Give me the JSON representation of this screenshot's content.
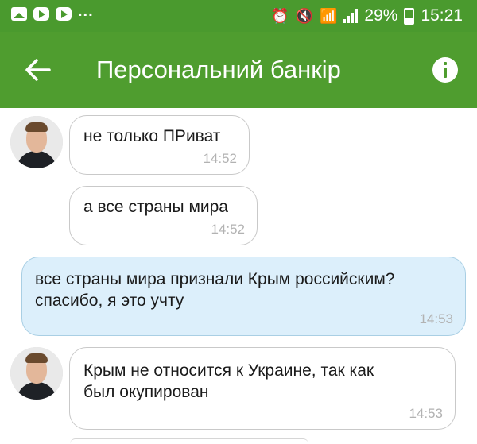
{
  "status_bar": {
    "time": "15:21",
    "battery": "29%",
    "overflow": "...",
    "icons": [
      "picture-icon",
      "youtube-icon",
      "youtube-icon",
      "alarm-icon",
      "mute-icon",
      "wifi-icon",
      "signal-icon",
      "battery-icon"
    ]
  },
  "header": {
    "title": "Персональний банкір",
    "back_icon": "arrow-left-icon",
    "info_icon": "info-icon",
    "bg": "#4f9d2f"
  },
  "messages": [
    {
      "sender": "bot",
      "text": [
        "не только ПРиват"
      ],
      "time": "14:52"
    },
    {
      "sender": "bot",
      "text": [
        "а все страны мира"
      ],
      "time": "14:52"
    },
    {
      "sender": "user",
      "text": [
        "все страны мира признали Крым российским?",
        "спасибо, я это учту"
      ],
      "time": "14:53"
    },
    {
      "sender": "bot",
      "text": [
        "Крым не относится к Украине, так как",
        "был окупирован"
      ],
      "time": "14:53"
    }
  ]
}
